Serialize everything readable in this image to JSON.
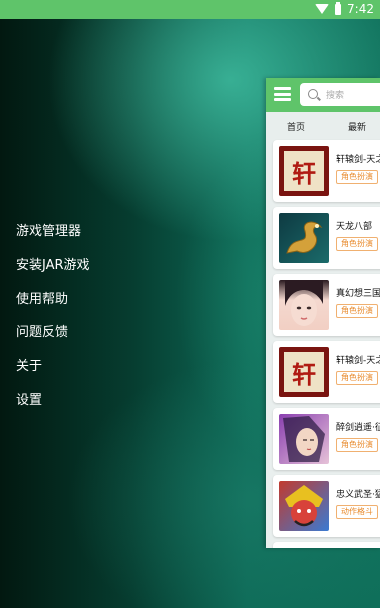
{
  "status_bar": {
    "time": "7:42"
  },
  "drawer_menu": {
    "items": [
      "游戏管理器",
      "安装JAR游戏",
      "使用帮助",
      "问题反馈",
      "关于",
      "设置"
    ]
  },
  "main": {
    "search_placeholder": "搜索",
    "tabs": [
      "首页",
      "最新"
    ],
    "games": [
      {
        "title": "轩辕剑-天之",
        "tag": "角色扮演",
        "icon": "xuanyuan-logo-icon"
      },
      {
        "title": "天龙八部",
        "tag": "角色扮演",
        "icon": "golden-dragon-icon"
      },
      {
        "title": "真幻想三国",
        "tag": "角色扮演",
        "icon": "girl-portrait-icon"
      },
      {
        "title": "轩辕剑-天之",
        "tag": "角色扮演",
        "icon": "xuanyuan-logo-icon"
      },
      {
        "title": "醉剑逍遥·征",
        "tag": "角色扮演",
        "icon": "warrior-portrait-icon"
      },
      {
        "title": "忠义武圣·猛",
        "tag": "动作格斗",
        "icon": "hero-portrait-icon"
      }
    ],
    "thumb_glyph": "轩"
  },
  "colors": {
    "accent": "#5fc46a",
    "tag": "#e8892a"
  }
}
